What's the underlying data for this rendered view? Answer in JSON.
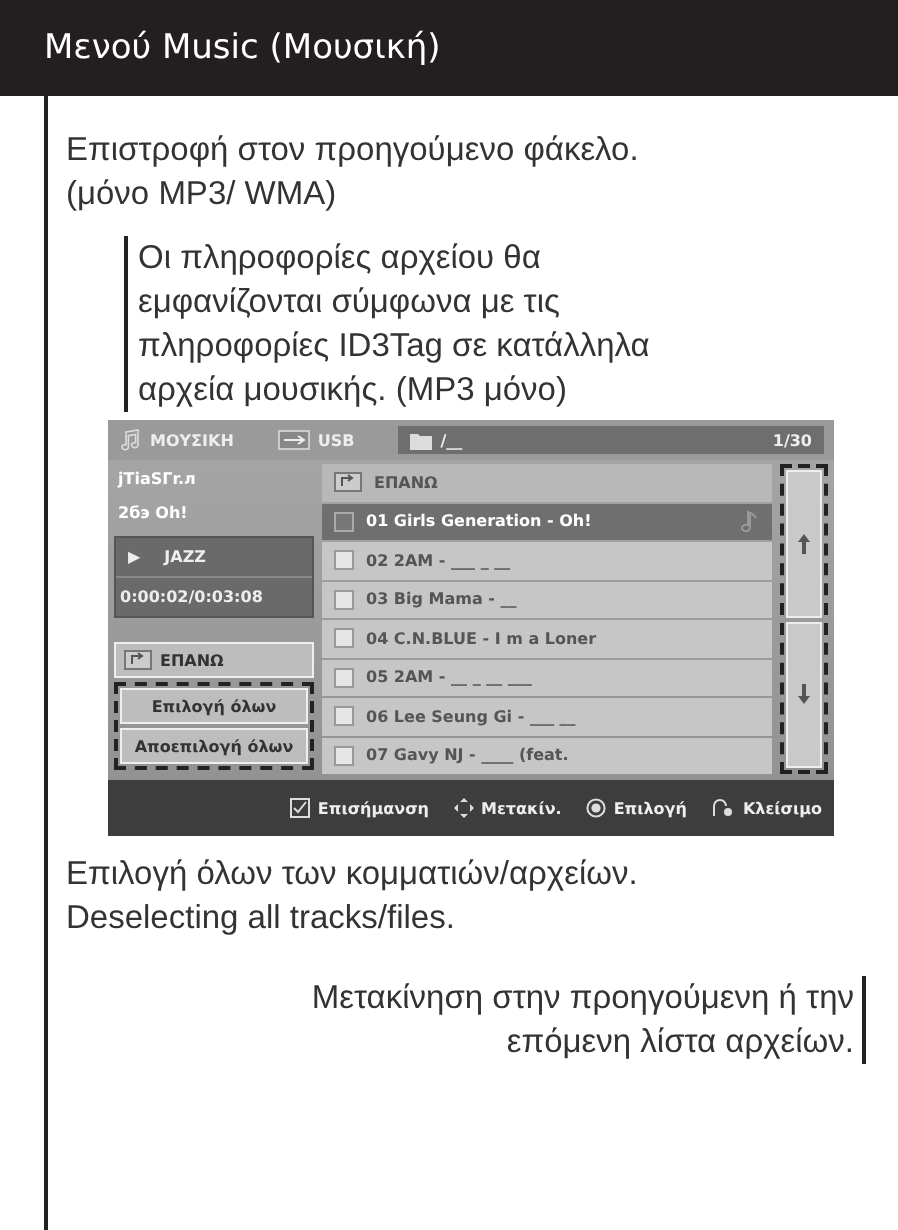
{
  "header": {
    "title": "Μενού Music (Μουσική)"
  },
  "callouts": [
    "Επιστροφή στον προηγούμενο φάκελο. (μόνο MP3/ WMA)",
    "Οι πληροφορίες αρχείου θα εμφανίζονται σύμφωνα με τις πληροφορίες ID3Tag σε κατάλληλα αρχεία μουσικής. (MP3 μόνο)"
  ],
  "screen": {
    "title": "ΜΟΥΣΙΚΗ",
    "source": "USB",
    "path": "/__",
    "counter": "1/30",
    "info": [
      "jTiaSΓr.л",
      "2бэ  Oh!"
    ],
    "now_playing": {
      "icon": "▶",
      "genre": "JAZZ",
      "time": "0:00:02/0:03:08"
    },
    "up_button": "ΕΠΑΝΩ",
    "buttons": [
      "Επιλογή όλων",
      "Αποεπιλογή όλων"
    ],
    "list_header": "ΕΠΑΝΩ",
    "tracks": [
      {
        "title": "01 Girls Generation - Oh!",
        "selected": true,
        "checked": false
      },
      {
        "title": "02 2AM - ___ _ __",
        "selected": false,
        "checked": false
      },
      {
        "title": "03 Big Mama - __",
        "selected": false,
        "checked": false
      },
      {
        "title": "04 C.N.BLUE - I m a Loner",
        "selected": false,
        "checked": false
      },
      {
        "title": "05 2AM - __ _ __ ___",
        "selected": false,
        "checked": false
      },
      {
        "title": "06 Lee Seung Gi - ___ __",
        "selected": false,
        "checked": false
      },
      {
        "title": "07 Gavy NJ - ____ (feat.",
        "selected": false,
        "checked": false
      }
    ],
    "hints": [
      {
        "kind": "mark",
        "label": "Επισήμανση"
      },
      {
        "kind": "move",
        "label": "Μετακίν."
      },
      {
        "kind": "select",
        "label": "Επιλογή"
      },
      {
        "kind": "close",
        "label": "Κλείσιμο"
      }
    ]
  },
  "captions": [
    "Επιλογή όλων των κομματιών/αρχείων. Deselecting all tracks/files.",
    "Μετακίνηση στην προηγούμενη ή την επόμενη λίστα αρχείων."
  ]
}
